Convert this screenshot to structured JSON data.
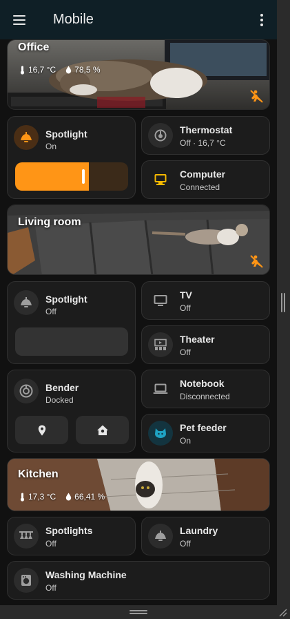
{
  "header": {
    "title": "Mobile"
  },
  "colors": {
    "accent_orange": "#ff9516",
    "header_bg": "#0f1f26",
    "tile_bg": "#1c1c1c",
    "cyan": "#1fa3c4"
  },
  "areas": [
    {
      "name": "Office",
      "temperature": "16,7 °C",
      "humidity": "78,5 %"
    },
    {
      "name": "Living room"
    },
    {
      "name": "Kitchen",
      "temperature": "17,3 °C",
      "humidity": "66,41 %"
    }
  ],
  "office": {
    "spotlight": {
      "name": "Spotlight",
      "state": "On",
      "brightness": 0.65,
      "icon": "ceiling-light-icon"
    },
    "thermostat": {
      "name": "Thermostat",
      "state": "Off · 16,7 °C",
      "icon": "thermostat-icon"
    },
    "computer": {
      "name": "Computer",
      "state": "Connected",
      "icon": "desktop-computer-icon"
    }
  },
  "living_room": {
    "spotlight": {
      "name": "Spotlight",
      "state": "Off",
      "icon": "ceiling-light-icon"
    },
    "tv": {
      "name": "TV",
      "state": "Off",
      "icon": "television-icon"
    },
    "theater": {
      "name": "Theater",
      "state": "Off",
      "icon": "home-theater-icon"
    },
    "bender": {
      "name": "Bender",
      "state": "Docked",
      "icon": "robot-vacuum-icon"
    },
    "notebook": {
      "name": "Notebook",
      "state": "Disconnected",
      "icon": "laptop-icon"
    },
    "pet_feeder": {
      "name": "Pet feeder",
      "state": "On",
      "icon": "cat-icon"
    }
  },
  "kitchen": {
    "spotlights": {
      "name": "Spotlights",
      "state": "Off",
      "icon": "ceiling-lights-icon"
    },
    "laundry": {
      "name": "Laundry",
      "state": "Off",
      "icon": "ceiling-light-icon"
    },
    "washing_machine": {
      "name": "Washing Machine",
      "state": "Off",
      "icon": "washing-machine-icon"
    }
  }
}
